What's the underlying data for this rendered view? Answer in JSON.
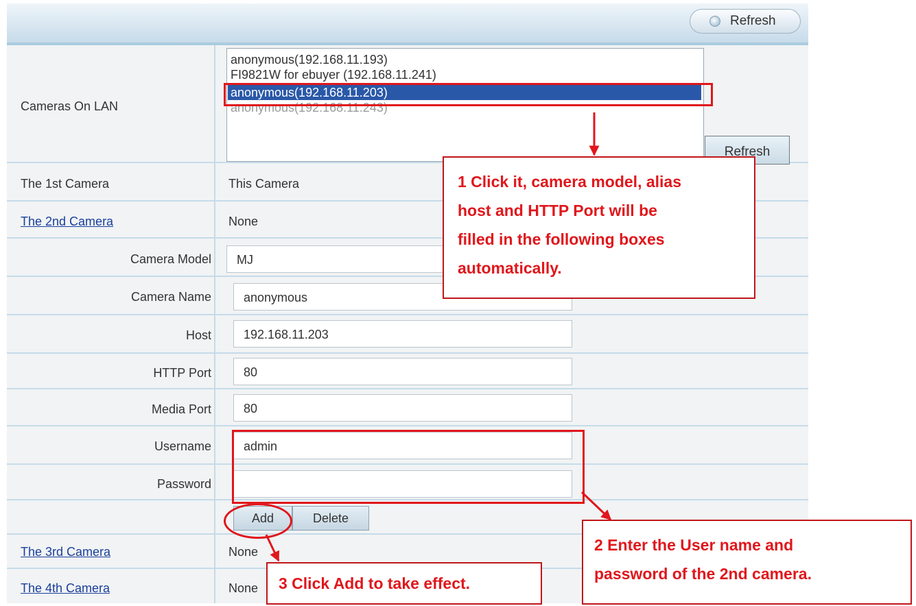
{
  "toolbar": {
    "refresh_label": "Refresh"
  },
  "lan": {
    "label": "Cameras On LAN",
    "options": [
      "anonymous(192.168.11.193)",
      "FI9821W for ebuyer (192.168.11.241)",
      "anonymous(192.168.11.203)",
      "anonymous(192.168.11.243)"
    ],
    "selected_index": 2,
    "refresh_label": "Refresh"
  },
  "cameras": {
    "first": {
      "label": "The 1st Camera",
      "value": "This Camera"
    },
    "second": {
      "label": "The 2nd Camera",
      "value": "None"
    },
    "third": {
      "label": "The 3rd Camera",
      "value": "None"
    },
    "fourth": {
      "label": "The 4th Camera",
      "value": "None"
    }
  },
  "form": {
    "model": {
      "label": "Camera Model",
      "value": "MJ"
    },
    "name": {
      "label": "Camera Name",
      "value": "anonymous"
    },
    "host": {
      "label": "Host",
      "value": "192.168.11.203"
    },
    "http_port": {
      "label": "HTTP Port",
      "value": "80"
    },
    "media_port": {
      "label": "Media Port",
      "value": "80"
    },
    "username": {
      "label": "Username",
      "value": "admin"
    },
    "password": {
      "label": "Password",
      "value": ""
    },
    "add_label": "Add",
    "delete_label": "Delete"
  },
  "callouts": {
    "step1_lines": [
      "1 Click it, camera model, alias",
      "host and HTTP Port will be",
      "filled in the following boxes",
      "automatically."
    ],
    "step2_lines": [
      "2 Enter the User name and",
      "password of the 2nd camera."
    ],
    "step3": "3 Click Add to take effect."
  },
  "colors": {
    "annotation_red": "#e0171c",
    "selection_blue": "#2a58a8",
    "row_divider": "#c5dbe9"
  }
}
